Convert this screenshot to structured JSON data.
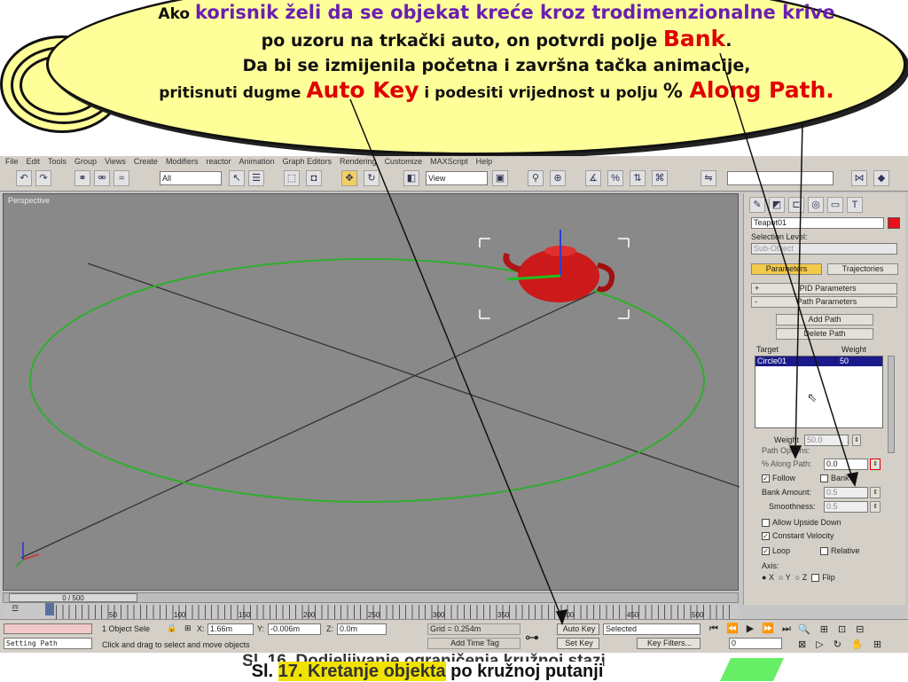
{
  "bubble": {
    "line1_pre": "Ako ",
    "line1_hl": "korisnik želi da se objekat kreće kroz trodimenzionalne krive",
    "line2_pre": "po uzoru na trkački auto, on potvrdi polje ",
    "line2_red": "Bank",
    "line2_post": ".",
    "line3": "Da bi se izmijenila početna i završna tačka animacije,",
    "line4_pre": "pritisnuti dugme ",
    "line4_red1": "Auto Key",
    "line4_mid": " i podesiti vrijednost u polju ",
    "line4_pct": "% ",
    "line4_red2": "Along Path."
  },
  "menu": [
    "File",
    "Edit",
    "Tools",
    "Group",
    "Views",
    "Create",
    "Modifiers",
    "reactor",
    "Animation",
    "Graph Editors",
    "Rendering",
    "Customize",
    "MAXScript",
    "Help"
  ],
  "toolbar": {
    "selection_filter": "All",
    "ref_coord": "View"
  },
  "viewport": {
    "label": "Perspective"
  },
  "panel": {
    "object_name": "Teapot01",
    "selection_level_label": "Selection Level:",
    "selection_level_value": "Sub-Object",
    "tab_parameters": "Parameters",
    "tab_trajectories": "Trajectories",
    "rollout_pid": "PID Parameters",
    "rollout_path": "Path Parameters",
    "btn_add_path": "Add Path",
    "btn_delete_path": "Delete Path",
    "col_target": "Target",
    "col_weight": "Weight",
    "list_target": "Circle01",
    "list_weight": "50",
    "weight_label": "Weight",
    "weight_value": "50.0",
    "path_options_label": "Path Options:",
    "along_path_label": "% Along Path:",
    "along_path_value": "0.0",
    "follow_label": "Follow",
    "bank_label": "Bank",
    "bank_amount_label": "Bank Amount:",
    "bank_amount_value": "0.5",
    "smoothness_label": "Smoothness:",
    "smoothness_value": "0.5",
    "allow_upside_label": "Allow Upside Down",
    "constant_velocity_label": "Constant Velocity",
    "loop_label": "Loop",
    "relative_label": "Relative",
    "axis_label": "Axis:",
    "axis_x": "X",
    "axis_y": "Y",
    "axis_z": "Z",
    "flip_label": "Flip"
  },
  "timeline": {
    "frame_display": "0 / 500",
    "ticks": [
      "50",
      "100",
      "150",
      "200",
      "250",
      "300",
      "350",
      "400",
      "450",
      "500"
    ]
  },
  "status": {
    "macro": "Setting Path",
    "selection_count": "1 Object Sele",
    "x_label": "X:",
    "x_value": "1.66m",
    "y_label": "Y:",
    "y_value": "-0.006m",
    "z_label": "Z:",
    "z_value": "0.0m",
    "grid": "Grid = 0.254m",
    "prompt": "Click and drag to select and move objects",
    "add_time_tag": "Add Time Tag",
    "auto_key": "Auto Key",
    "auto_key_mode": "Selected",
    "set_key": "Set Key",
    "key_filters": "Key Filters...",
    "frame": "0"
  },
  "caption_back": "Sl. 16. Dodjeljivanje ograničenja kružnoj stazi",
  "caption_front_prefix": "Sl. ",
  "caption_front_num": "17. Kretanje objekta",
  "caption_front_rest": " po kružnoj putanji",
  "colors": {
    "bubble_fill": "#ffff99",
    "highlight_purple": "#6a1fb0",
    "highlight_red": "#e00000",
    "teapot": "#cc1a1a",
    "path_circle": "#2fae2f"
  }
}
